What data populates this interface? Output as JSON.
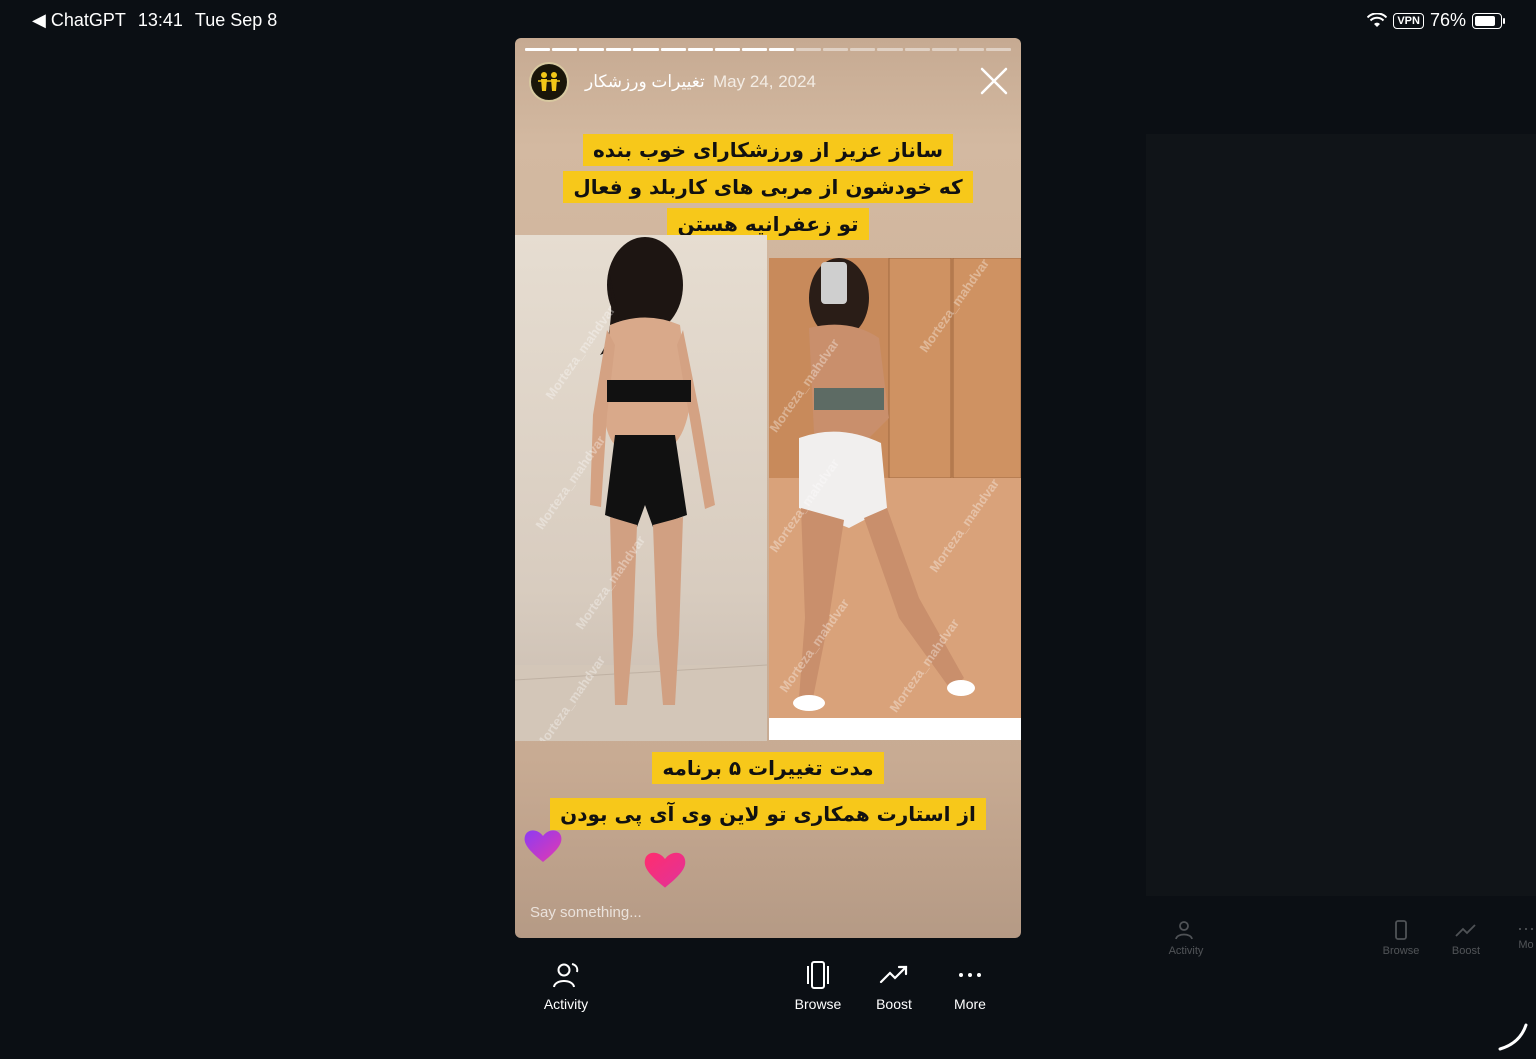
{
  "status_bar": {
    "back_app": "◀ ChatGPT",
    "time": "13:41",
    "date": "Tue Sep 8",
    "vpn": "VPN",
    "battery": "76%"
  },
  "story": {
    "account_name": "تغییرات ورزشکار",
    "date": "May 24, 2024",
    "progress_total": 18,
    "progress_done": 10,
    "caption_top": [
      "ساناز عزیز از ورزشکارای خوب بنده",
      "که خودشون از مربی های کاربلد و فعال",
      "تو زعفرانیه هستن"
    ],
    "caption_bottom": [
      "مدت تغییرات ۵ برنامه",
      "از استارت همکاری تو لاین وی آی پی بودن"
    ],
    "watermark": "Morteza_mahdvar",
    "reply_placeholder": "Say something..."
  },
  "nav": {
    "activity": "Activity",
    "browse": "Browse",
    "boost": "Boost",
    "more": "More"
  },
  "ghost_nav": {
    "activity": "Activity",
    "browse": "Browse",
    "boost": "Boost",
    "more": "Mo"
  }
}
